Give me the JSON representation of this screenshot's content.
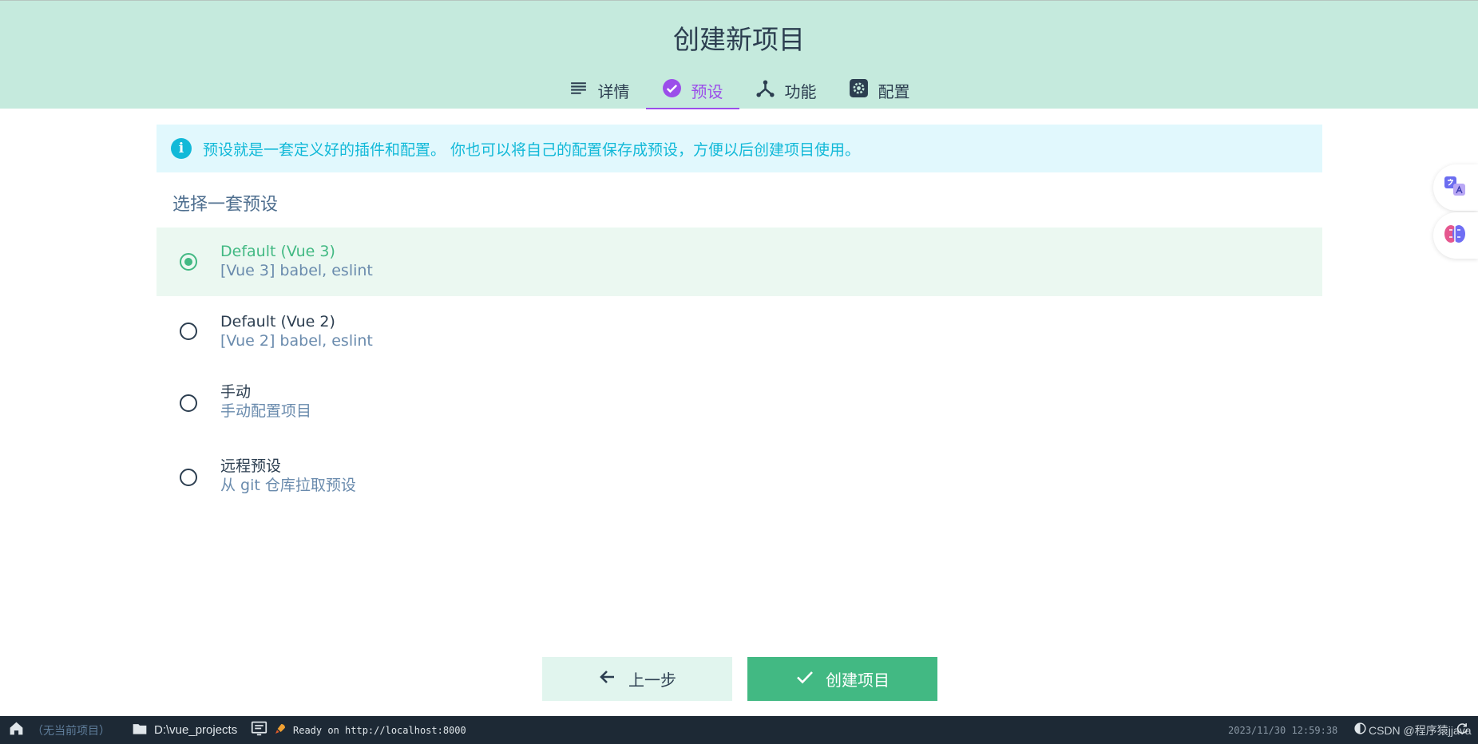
{
  "header": {
    "title": "创建新项目",
    "tabs": [
      {
        "label": "详情",
        "icon": "list-icon",
        "active": false
      },
      {
        "label": "预设",
        "icon": "check-circle-icon",
        "active": true
      },
      {
        "label": "功能",
        "icon": "branch-icon",
        "active": false
      },
      {
        "label": "配置",
        "icon": "gear-icon",
        "active": false
      }
    ]
  },
  "info": {
    "text": "预设就是一套定义好的插件和配置。 你也可以将自己的配置保存成预设，方便以后创建项目使用。",
    "icon_glyph": "i"
  },
  "section_title": "选择一套预设",
  "presets": [
    {
      "name": "Default (Vue 3)",
      "desc": "[Vue 3] babel, eslint",
      "selected": true
    },
    {
      "name": "Default (Vue 2)",
      "desc": "[Vue 2] babel, eslint",
      "selected": false
    },
    {
      "name": "手动",
      "desc": "手动配置项目",
      "selected": false
    },
    {
      "name": "远程预设",
      "desc": "从 git 仓库拉取预设",
      "selected": false
    }
  ],
  "actions": {
    "back_label": "上一步",
    "create_label": "创建项目"
  },
  "statusbar": {
    "current_project": "（无当前项目）",
    "path": "D:\\vue_projects",
    "log": "Ready on http://localhost:8000",
    "time": "2023/11/30 12:59:38",
    "watermark": "CSDN @程序猿jjava"
  },
  "colors": {
    "header_bg": "#c5eadd",
    "accent_purple": "#9b4dea",
    "accent_green": "#42b983",
    "info_blue": "#12b9d8",
    "statusbar_bg": "#1d2935"
  }
}
